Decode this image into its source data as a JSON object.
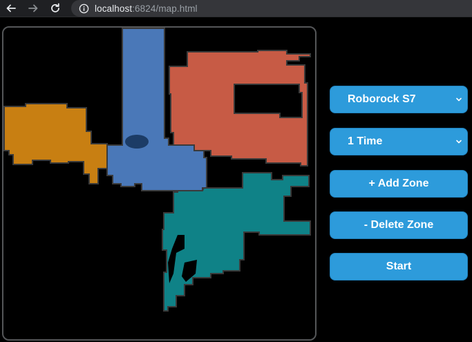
{
  "browser": {
    "url_host": "localhost",
    "url_rest": ":6824/map.html"
  },
  "controls": {
    "robot_select": "Roborock S7",
    "frequency_select": "1 Time",
    "add_zone_label": "+ Add Zone",
    "delete_zone_label": "- Delete Zone",
    "start_label": "Start"
  },
  "map": {
    "rooms": [
      {
        "name": "blue-room",
        "color": "#4a78b8"
      },
      {
        "name": "orange-room",
        "color": "#c87f12"
      },
      {
        "name": "red-room",
        "color": "#c75b45"
      },
      {
        "name": "teal-room",
        "color": "#0f8287"
      }
    ],
    "wall_color": "#3a3a3a",
    "obstacle_color": "#1c3c66"
  },
  "colors": {
    "button_bg": "#2d9bdb",
    "button_text": "#ffffff",
    "page_bg": "#000000",
    "frame_border": "#555759"
  }
}
